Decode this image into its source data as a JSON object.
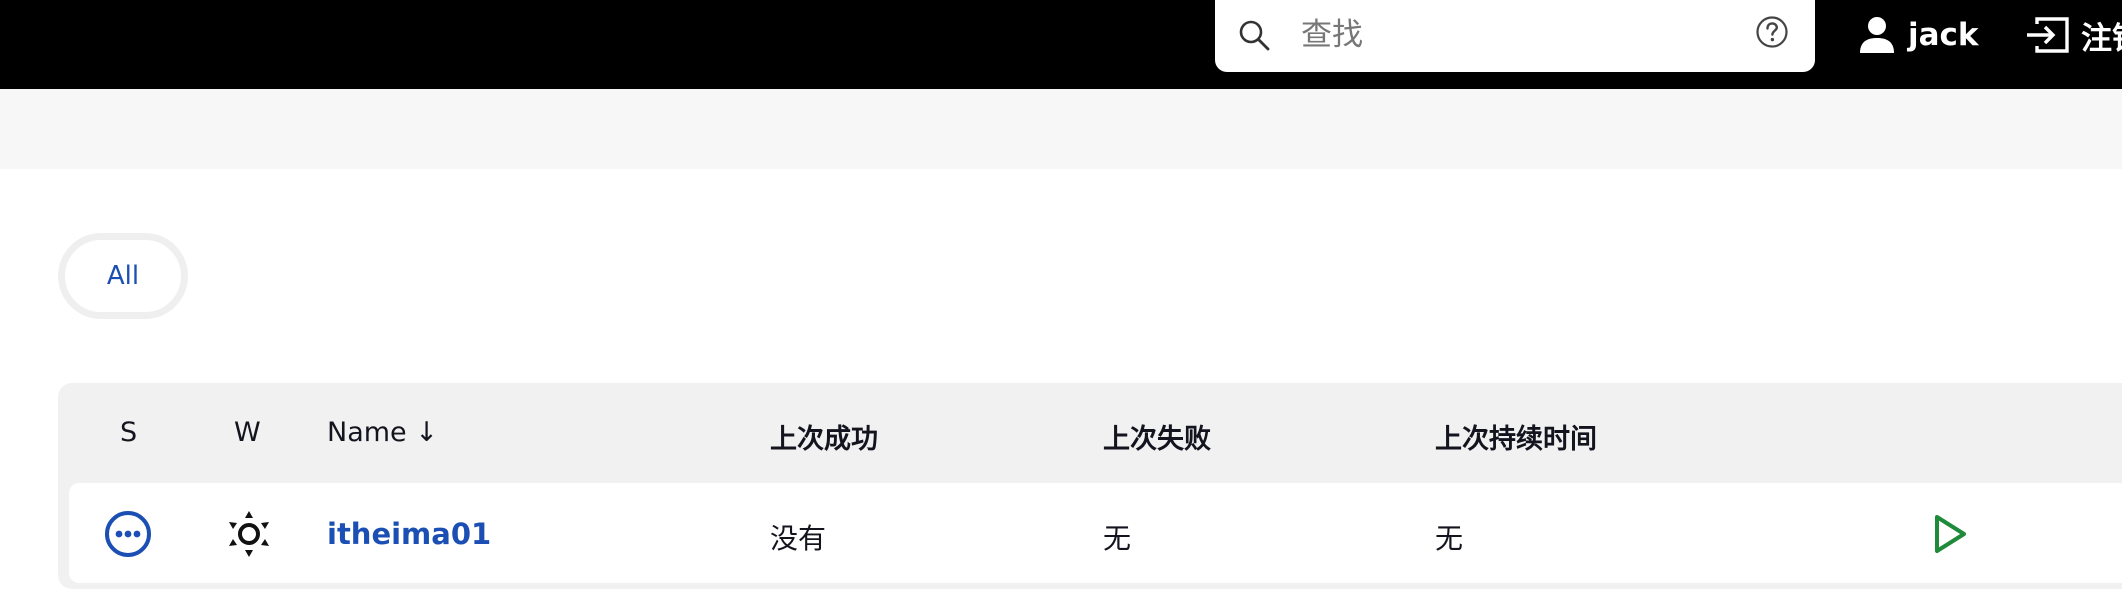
{
  "header": {
    "search": {
      "placeholder": "查找"
    },
    "user": {
      "name": "jack"
    },
    "logout": {
      "label": "注销"
    }
  },
  "views": {
    "tabs": [
      {
        "label": "All"
      }
    ]
  },
  "jobs_table": {
    "columns": {
      "status": "S",
      "weather": "W",
      "name": "Name ↓",
      "last_success": "上次成功",
      "last_failure": "上次失败",
      "last_duration": "上次持续时间"
    },
    "rows": [
      {
        "status_icon": "not-built-icon",
        "weather_icon": "sunny-icon",
        "name": "itheima01",
        "last_success": "没有",
        "last_failure": "无",
        "last_duration": "无",
        "action_icon": "build-play-icon"
      }
    ]
  },
  "colors": {
    "accent": "#1b4fb4",
    "run": "#1e8a3a",
    "topbar": "#000000"
  }
}
